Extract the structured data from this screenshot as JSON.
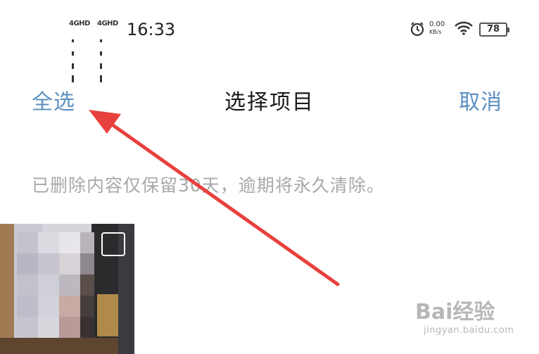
{
  "status_bar": {
    "signal1": "4GHD",
    "signal2": "4GHD",
    "time": "16:33",
    "speed_value": "0.00",
    "speed_unit": "KB/s",
    "battery": "78",
    "icons": [
      "alarm-icon",
      "wifi-icon",
      "battery-icon"
    ]
  },
  "header": {
    "select_all_label": "全选",
    "title": "选择项目",
    "cancel_label": "取消"
  },
  "notice": "已删除内容仅保留30天，逾期将永久清除。",
  "colors": {
    "accent": "#5b8fc2",
    "arrow": "#e8403d",
    "notice_text": "#a8a8a8"
  },
  "watermark": {
    "brand": "Bai经验",
    "url": "jingyan.baidu.com"
  }
}
